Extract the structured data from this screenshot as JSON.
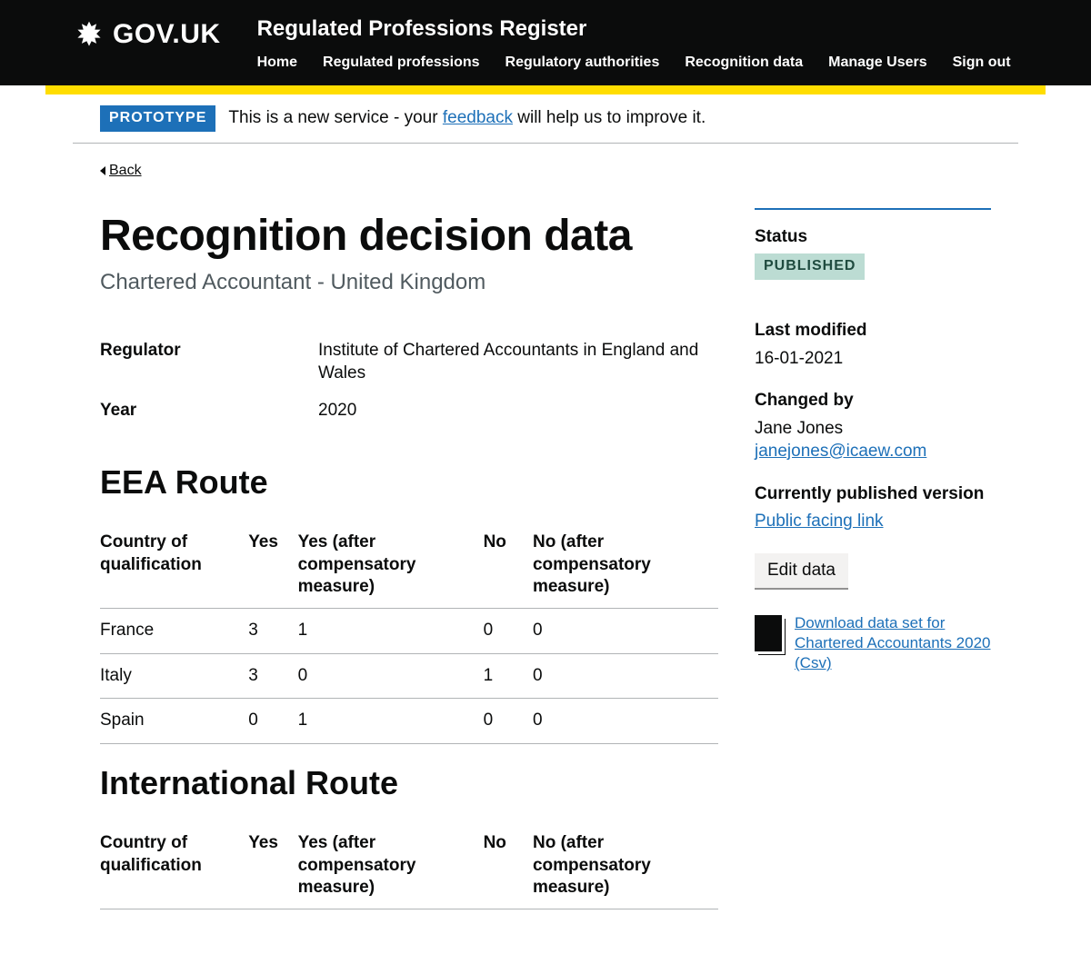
{
  "header": {
    "site": "GOV.UK",
    "service": "Regulated Professions Register",
    "nav": [
      "Home",
      "Regulated professions",
      "Regulatory authorities",
      "Recognition data",
      "Manage Users",
      "Sign out"
    ]
  },
  "phase": {
    "tag": "PROTOTYPE",
    "text_before": "This is a new service - your ",
    "link": "feedback",
    "text_after": " will help us to improve it."
  },
  "back": "Back",
  "page": {
    "title": "Recognition decision data",
    "subtitle": "Chartered Accountant - United Kingdom"
  },
  "summary": {
    "regulator_label": "Regulator",
    "regulator_value": "Institute of Chartered Accountants in England and Wales",
    "year_label": "Year",
    "year_value": "2020"
  },
  "columns": {
    "country": "Country of qualification",
    "yes": "Yes",
    "yes_comp": "Yes (after compensatory measure)",
    "no": "No",
    "no_comp": "No (after compensatory measure)"
  },
  "sections": {
    "eea": {
      "heading": "EEA Route",
      "rows": [
        {
          "country": "France",
          "yes": "3",
          "yes_comp": "1",
          "no": "0",
          "no_comp": "0"
        },
        {
          "country": "Italy",
          "yes": "3",
          "yes_comp": "0",
          "no": "1",
          "no_comp": "0"
        },
        {
          "country": "Spain",
          "yes": "0",
          "yes_comp": "1",
          "no": "0",
          "no_comp": "0"
        }
      ]
    },
    "intl": {
      "heading": "International Route"
    }
  },
  "sidebar": {
    "status_label": "Status",
    "status_value": "PUBLISHED",
    "modified_label": "Last modified",
    "modified_value": "16-01-2021",
    "changed_label": "Changed by",
    "changed_name": "Jane Jones",
    "changed_email": "janejones@icaew.com",
    "public_label": "Currently published version",
    "public_link": "Public facing link",
    "edit": "Edit data",
    "download": "Download data set for Chartered Accountants 2020 (Csv)"
  }
}
